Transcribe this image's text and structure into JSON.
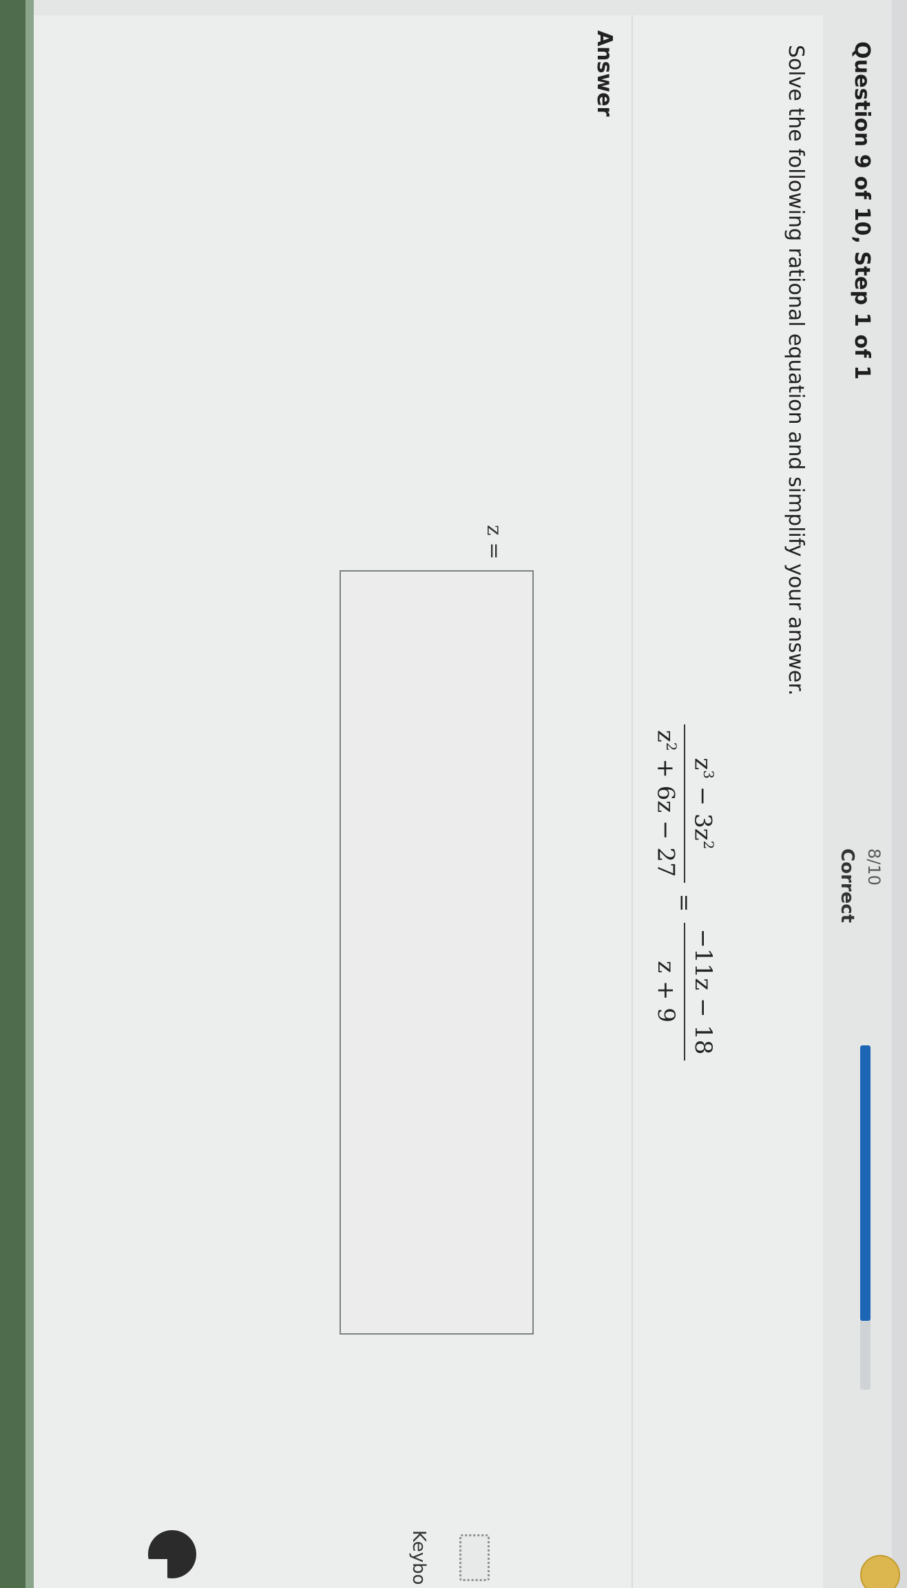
{
  "header": {
    "question_label": "Question 9 of 10, Step 1 of 1",
    "score": "8/10",
    "score_caption": "Correct",
    "progress_fraction": 0.8
  },
  "question": {
    "instruction": "Solve the following rational equation and simplify your answer.",
    "equation": {
      "lhs_numerator": "z³ − 3z²",
      "lhs_denominator": "z² + 6z − 27",
      "equals": "=",
      "rhs_numerator": "−11z − 18",
      "rhs_denominator": "z + 9"
    }
  },
  "answer": {
    "heading": "Answer",
    "variable_label": "z =",
    "input_value": ""
  },
  "sidebar": {
    "keyboard_label": "Keybo"
  },
  "colors": {
    "progress_fill": "#1c66b5",
    "coin": "#dcb64e"
  },
  "icons": [
    "coin-icon",
    "keyboard-icon",
    "tool-icon"
  ]
}
